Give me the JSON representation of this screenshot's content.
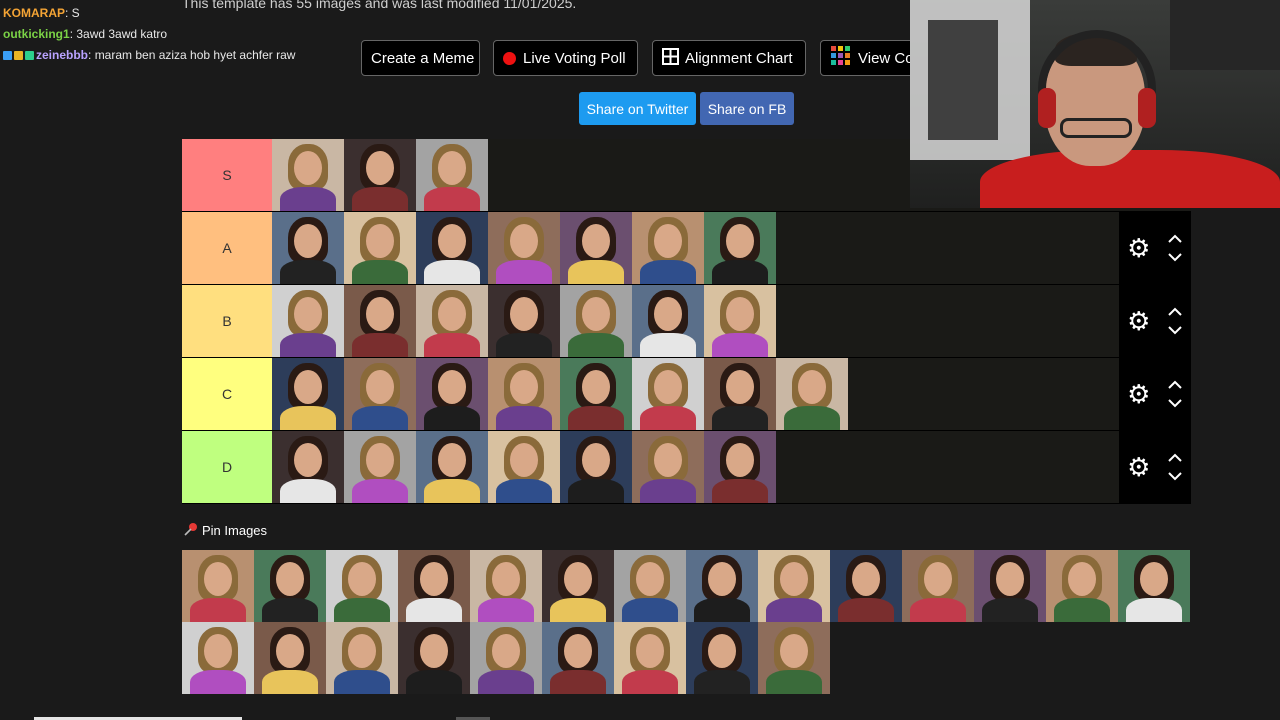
{
  "chat": [
    {
      "user": "KOMARAP",
      "color": "#f4a435",
      "msg": "S",
      "badges": []
    },
    {
      "user": "outkicking1",
      "color": "#7bd346",
      "msg": "3awd 3awd katro",
      "badges": []
    },
    {
      "user": "zeinebbb",
      "color": "#b9a2ff",
      "msg": "maram ben aziza hob hyet achfer raw",
      "badges": [
        "#3a9ef5",
        "#e9b425",
        "#2ccf8c"
      ]
    }
  ],
  "header": {
    "info_text": "This template has 55 images and was last modified 11/01/2025."
  },
  "buttons": {
    "create_meme": "Create a Meme",
    "live_poll": "Live Voting Poll",
    "alignment_chart": "Alignment Chart",
    "view_co": "View Co"
  },
  "share": {
    "twitter": "Share on Twitter",
    "fb": "Share on FB"
  },
  "tiers": [
    {
      "label": "S",
      "color": "#ff7f7f",
      "count": 3,
      "controls": false
    },
    {
      "label": "A",
      "color": "#ffbf7f",
      "count": 7,
      "controls": true
    },
    {
      "label": "B",
      "color": "#ffdf7f",
      "count": 7,
      "controls": true
    },
    {
      "label": "C",
      "color": "#ffff7f",
      "count": 8,
      "controls": true
    },
    {
      "label": "D",
      "color": "#bfff7f",
      "count": 7,
      "controls": true
    }
  ],
  "pin": {
    "title": "Pin Images",
    "count": 23
  },
  "colors": {
    "page_bg": "#1a1a1a",
    "twitter": "#1d9bf0",
    "facebook": "#4267b2"
  }
}
